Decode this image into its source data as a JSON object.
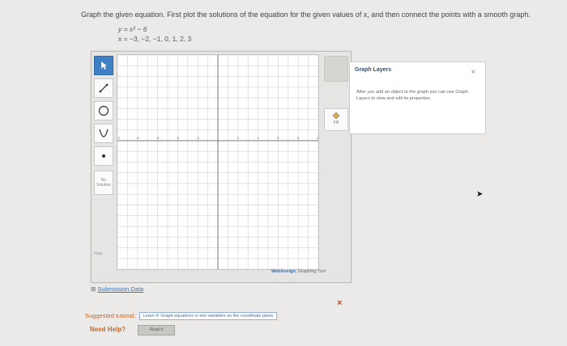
{
  "prompt": {
    "instruction": "Graph the given equation. First plot the solutions of the equation for the given values of x, and then connect the points with a smooth graph.",
    "equation": "y = x² − 6",
    "x_values": "x = −3, −2, −1, 0, 1, 2, 3"
  },
  "graph": {
    "x_tick_labels": [
      "-10",
      "-8",
      "-6",
      "-4",
      "-2",
      "2",
      "4",
      "6",
      "8",
      "10"
    ],
    "y_tick_labels": [
      "10"
    ],
    "brand_name": "WebAssign.",
    "brand_suffix": "Graphing Tool"
  },
  "tools": {
    "no_solution_label_1": "No",
    "no_solution_label_2": "Solution",
    "fill_label": "Fill",
    "help_label": "Help"
  },
  "layers": {
    "title": "Graph Layers",
    "collapse_icon": "«",
    "description": "After you add an object to the graph you can use Graph Layers to view and edit its properties."
  },
  "submission": {
    "toggle": "⊞",
    "label": "Submission Data"
  },
  "footer": {
    "suggested_label": "Suggested tutorial:",
    "tutorial_link": "Learn It: Graph equations in two variables on the coordinate plane",
    "need_help": "Need Help?",
    "read_it": "Read It",
    "close": "×"
  },
  "colors": {
    "accent": "#3f7fc4",
    "help_orange": "#c26a2e"
  }
}
